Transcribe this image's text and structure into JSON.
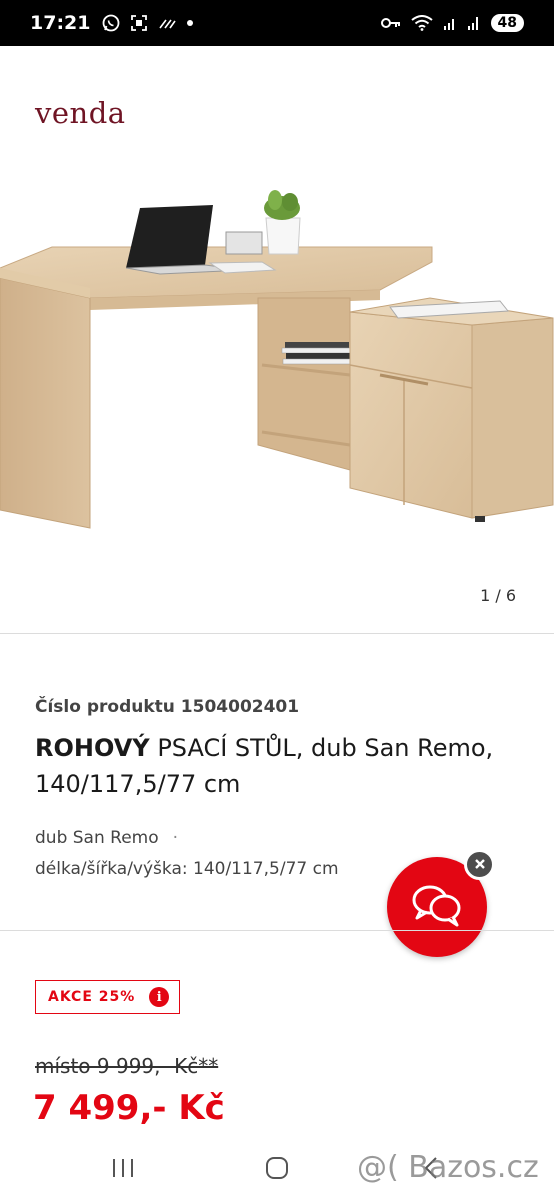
{
  "status_bar": {
    "time": "17:21",
    "battery": "48",
    "icons_left": [
      "whatsapp-icon",
      "screenshot-icon",
      "signal-bars-icon",
      "dot-icon"
    ],
    "icons_right": [
      "key-icon",
      "wifi-icon",
      "cell-signal-icon",
      "cell-signal-icon"
    ]
  },
  "brand": "venda",
  "gallery": {
    "pager": "1 / 6"
  },
  "product": {
    "number_label": "Číslo produktu 1504002401",
    "title_bold": "ROHOVÝ",
    "title_rest": " PSACÍ STŮL, dub San Remo, 140/117,5/77 cm",
    "attr_color": "dub San Remo",
    "attr_dot": "·",
    "attr_dimensions": "délka/šířka/výška: 140/117,5/77 cm"
  },
  "sale": {
    "badge": "AKCE 25%",
    "info_glyph": "i",
    "old_price": "místo 9 999,- Kč**",
    "new_price": "7 499,- Kč"
  },
  "watermark": "@( Bazos.cz",
  "colors": {
    "accent": "#e30613",
    "brand": "#6f1424"
  }
}
